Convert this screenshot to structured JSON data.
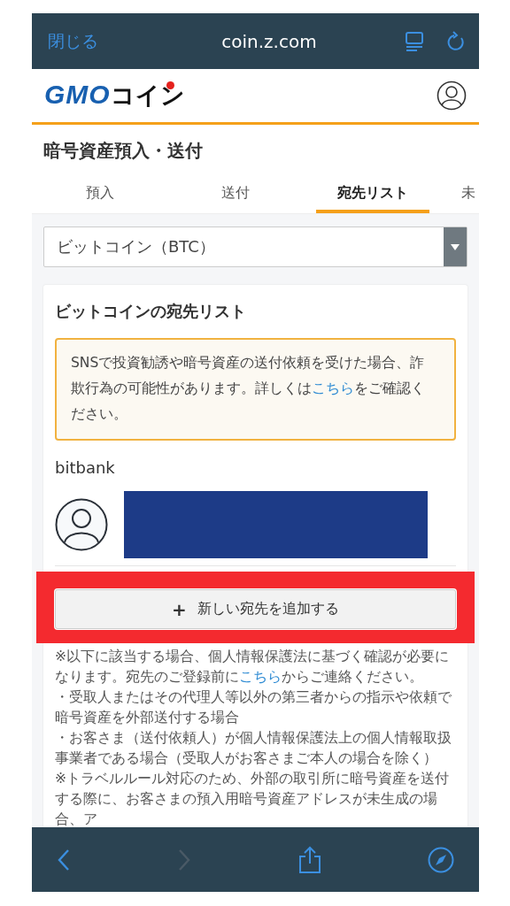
{
  "browser": {
    "close": "閉じる",
    "url": "coin.z.com"
  },
  "header": {
    "logo_latin": "GMO",
    "logo_kana": "コイン"
  },
  "page_title": "暗号資産預入・送付",
  "tabs": [
    {
      "label": "預入",
      "selected": false
    },
    {
      "label": "送付",
      "selected": false
    },
    {
      "label": "宛先リスト",
      "selected": true
    },
    {
      "label": "未",
      "selected": false
    }
  ],
  "currency_select": {
    "value": "ビットコイン（BTC）"
  },
  "card": {
    "title": "ビットコインの宛先リスト",
    "warning": [
      {
        "text": "SNSで投資勧誘や暗号資産の送付依頼を受けた場合、詐欺行為の可能性があります。詳しくは",
        "kind": "text"
      },
      {
        "text": "こちら",
        "kind": "link"
      },
      {
        "text": "をご確認ください。",
        "kind": "text"
      }
    ],
    "entries": [
      {
        "name": "bitbank",
        "redacted": true
      }
    ],
    "add_button": {
      "icon": "+",
      "label": "新しい宛先を追加する",
      "highlighted": true
    }
  },
  "notes": [
    [
      {
        "text": "※以下に該当する場合、個人情報保護法に基づく確認が必要になります。宛先のご登録前に",
        "kind": "text"
      },
      {
        "text": "こちら",
        "kind": "link"
      },
      {
        "text": "からご連絡ください。",
        "kind": "text"
      }
    ],
    [
      {
        "text": "・受取人またはその代理人等以外の第三者からの指示や依頼で暗号資産を外部送付する場合",
        "kind": "text"
      }
    ],
    [
      {
        "text": "・お客さま（送付依頼人）が個人情報保護法上の個人情報取扱事業者である場合（受取人がお客さまご本人の場合を除く）",
        "kind": "text"
      }
    ],
    [
      {
        "text": "※トラベルルール対応のため、外部の取引所に暗号資産を送付する際に、お客さまの預入用暗号資産アドレスが未生成の場合、ア",
        "kind": "text"
      }
    ]
  ]
}
